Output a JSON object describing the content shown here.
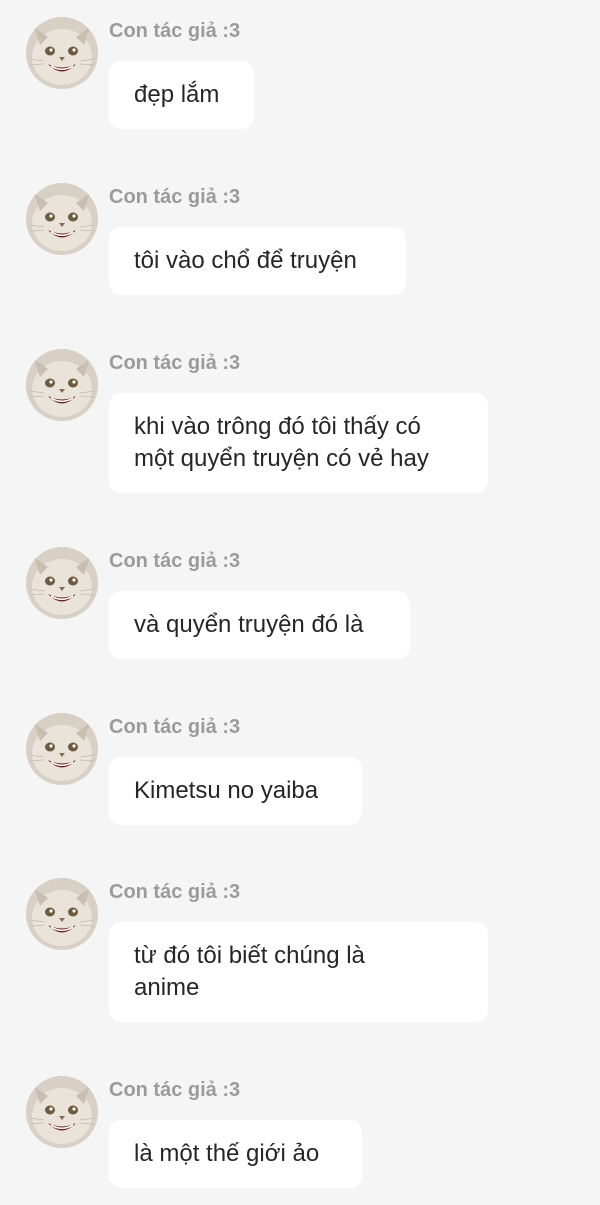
{
  "messages": [
    {
      "sender": "Con tác giả :3",
      "lines": [
        "đẹp lắm"
      ]
    },
    {
      "sender": "Con tác giả :3",
      "lines": [
        "tôi vào chổ để truyện"
      ]
    },
    {
      "sender": "Con tác giả :3",
      "lines": [
        "khi vào trông đó tôi thấy có",
        "một quyển truyện có vẻ hay"
      ]
    },
    {
      "sender": "Con tác giả :3",
      "lines": [
        "và quyển truyện đó là"
      ]
    },
    {
      "sender": "Con tác giả :3",
      "lines": [
        "Kimetsu no yaiba"
      ]
    },
    {
      "sender": "Con tác giả :3",
      "lines": [
        "từ đó tôi biết chúng là",
        "anime"
      ]
    },
    {
      "sender": "Con tác giả :3",
      "lines": [
        "là một thế giới ảo"
      ]
    }
  ],
  "avatar_icon": "cat-face-avatar-icon"
}
